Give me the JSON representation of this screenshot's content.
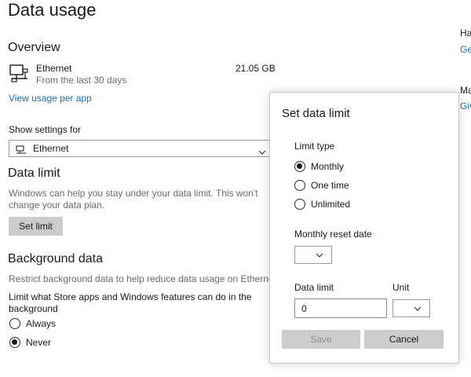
{
  "page_title": "Data usage",
  "overview": {
    "heading": "Overview",
    "network_name": "Ethernet",
    "network_period": "From the last 30 days",
    "network_usage": "21.05 GB",
    "view_usage_link": "View usage per app"
  },
  "show_settings": {
    "label": "Show settings for",
    "selected": "Ethernet"
  },
  "data_limit_section": {
    "heading": "Data limit",
    "description_line1": "Windows can help you stay under your data limit. This won't",
    "description_line2": "change your data plan.",
    "set_limit_button": "Set limit"
  },
  "background_data": {
    "heading": "Background data",
    "description": "Restrict background data to help reduce data usage on Ethernet.",
    "limit_label_line1": "Limit what Store apps and Windows features can do in the",
    "limit_label_line2": "background",
    "options": [
      {
        "label": "Always",
        "checked": false
      },
      {
        "label": "Never",
        "checked": true
      }
    ]
  },
  "right_panel": {
    "section1_heading_partial": "Ha",
    "section1_link_partial": "Ge",
    "section2_heading_partial": "Ma",
    "section2_link_partial": "Giv"
  },
  "dialog": {
    "title": "Set data limit",
    "limit_type_label": "Limit type",
    "limit_type_options": [
      {
        "label": "Monthly",
        "checked": true
      },
      {
        "label": "One time",
        "checked": false
      },
      {
        "label": "Unlimited",
        "checked": false
      }
    ],
    "reset_date_label": "Monthly reset date",
    "reset_date_value": "",
    "data_limit_label": "Data limit",
    "data_limit_value": "0",
    "unit_label": "Unit",
    "unit_value": "",
    "save_button": "Save",
    "cancel_button": "Cancel"
  },
  "colors": {
    "link": "#1e6fbf",
    "button_bg": "#cccccc",
    "disabled_text": "#8f8f8f"
  }
}
